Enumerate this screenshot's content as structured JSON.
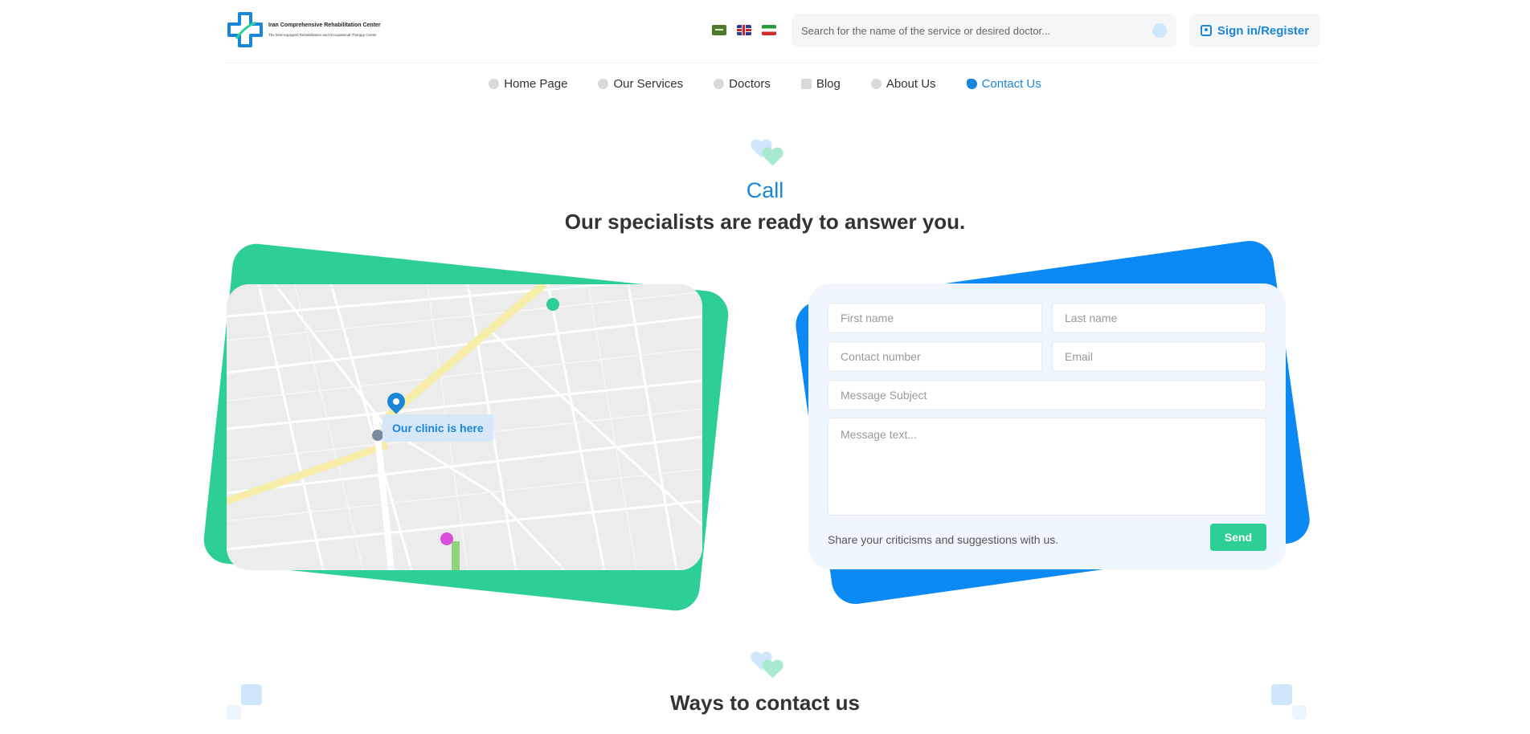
{
  "header": {
    "logo_title": "Iran Comprehensive Rehabilitation Center",
    "logo_subtitle": "The best-equipped Rehabilitation and Occupational Therapy Center",
    "search_placeholder": "Search for the name of the service or desired doctor...",
    "signin_label": "Sign in/Register",
    "languages": [
      "ar",
      "en",
      "fa"
    ]
  },
  "nav": {
    "items": [
      {
        "label": "Home Page",
        "icon": "home-icon"
      },
      {
        "label": "Our Services",
        "icon": "services-icon"
      },
      {
        "label": "Doctors",
        "icon": "doctors-icon"
      },
      {
        "label": "Blog",
        "icon": "blog-icon"
      },
      {
        "label": "About Us",
        "icon": "info-icon"
      },
      {
        "label": "Contact Us",
        "icon": "phone-icon",
        "active": true
      }
    ]
  },
  "contact": {
    "title": "Call",
    "subtitle": "Our specialists are ready to answer you.",
    "map_label": "Our clinic is here"
  },
  "form": {
    "first_name_placeholder": "First name",
    "last_name_placeholder": "Last name",
    "phone_placeholder": "Contact number",
    "email_placeholder": "Email",
    "subject_placeholder": "Message Subject",
    "message_placeholder": "Message text...",
    "note": "Share your criticisms and suggestions with us.",
    "send_label": "Send"
  },
  "ways": {
    "title": "Ways to contact us"
  },
  "colors": {
    "primary": "#1a86d9",
    "accent_green": "#2ecf95",
    "accent_blue": "#0b8af5"
  }
}
